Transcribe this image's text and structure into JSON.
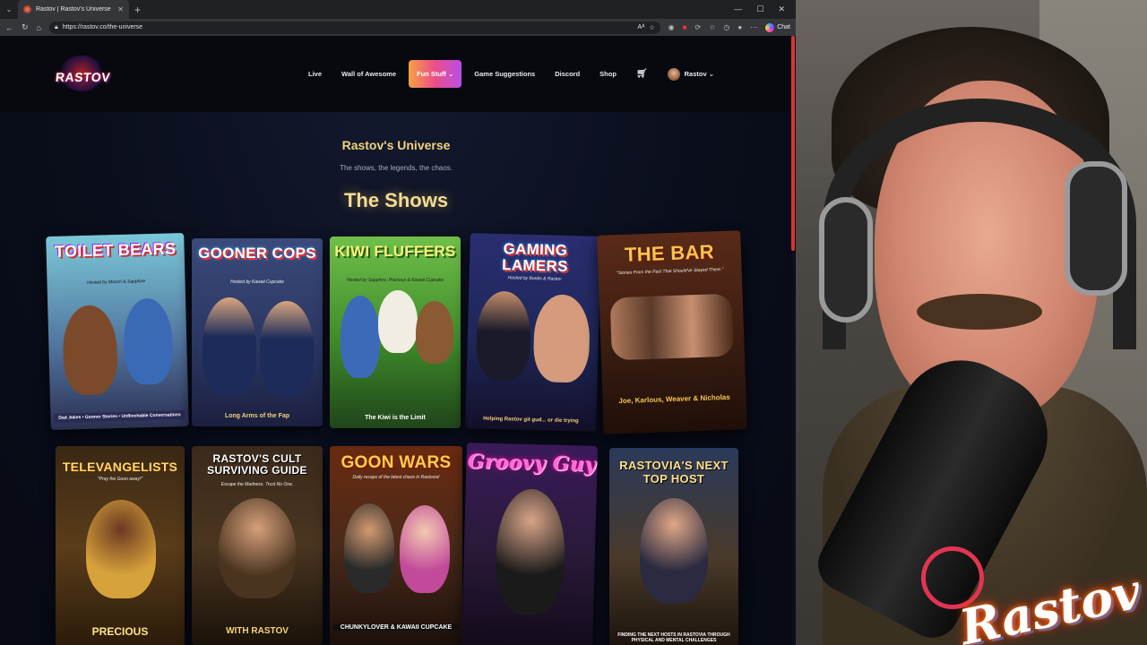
{
  "browser": {
    "tab_title": "Rastov | Rastov's Universe",
    "tab_close": "✕",
    "new_tab": "+",
    "url": "https://rastov.co/the-universe",
    "chat_label": "Chat",
    "window_controls": [
      "—",
      "☐",
      "✕"
    ]
  },
  "site": {
    "logo_text": "RASTOV",
    "nav": [
      "Live",
      "Wall of Awesome",
      "Fun Stuff ⌄",
      "Game Suggestions",
      "Discord",
      "Shop"
    ],
    "user_name": "Rastov ⌄",
    "colors": {
      "accent_gold": "#f2d27a",
      "fun_gradient": [
        "#f5a142",
        "#ec4d8a",
        "#b84fe8"
      ]
    }
  },
  "hero": {
    "title": "Rastov's Universe",
    "subtitle": "The shows, the legends, the chaos."
  },
  "shows_heading": "The Shows",
  "posters": [
    {
      "title": "TOILET BEARS",
      "tag": "Hosted by Mooch & Sapphire",
      "bottom": "Dad Jokes • Gooner Stories • Unflinchable Conversations"
    },
    {
      "title": "GOONER COPS",
      "tag": "Hosted by Kawaii Cupcake",
      "bottom": "Long Arms of the Fap"
    },
    {
      "title": "KIWI FLUFFERS",
      "tag": "Hosted by Sapphire, Precious & Kawaii Cupcake",
      "bottom": "The Kiwi is the Limit"
    },
    {
      "title": "GAMING LAMERS",
      "tag": "Hosted by Boobs & Rastov",
      "bottom": "Helping Rastov git gud... or die trying"
    },
    {
      "title": "THE BAR",
      "tag": "\"Stories From the Past That Should've Stayed There.\"",
      "bottom": "Joe, Karlous, Weaver & Nicholas"
    },
    {
      "title": "TELEVANGELISTS",
      "tag": "\"Pray the Goon away!\"",
      "bottom": "PRECIOUS"
    },
    {
      "title": "RASTOV'S CULT SURVIVING GUIDE",
      "tag": "Escape the Madness. Trust No One.",
      "bottom": "WITH RASTOV"
    },
    {
      "title": "GOON WARS",
      "tag": "Daily recaps of the latest chaos in Rastovia!",
      "bottom": "CHUNKYLOVER & KAWAII CUPCAKE"
    },
    {
      "title": "Groovy Guy",
      "tag": "",
      "bottom": ""
    },
    {
      "title": "RASTOVIA'S NEXT TOP HOST",
      "tag": "",
      "bottom": "FINDING THE NEXT HOSTS IN RASTOVIA THROUGH PHYSICAL AND MENTAL CHALLENGES"
    }
  ],
  "overlay_logo": "Rastov"
}
